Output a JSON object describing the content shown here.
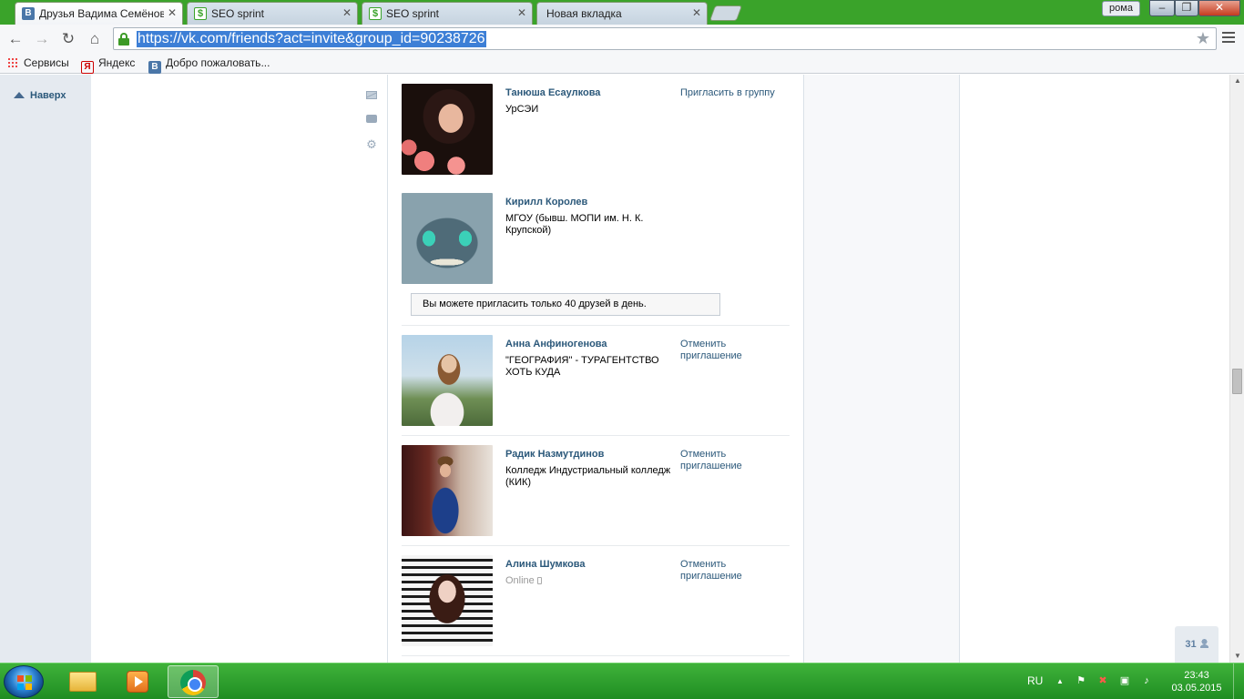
{
  "browser": {
    "tabs": [
      {
        "title": "Друзья Вадима Семёнова",
        "favicon": "vk-icon",
        "active": true
      },
      {
        "title": "SEO sprint",
        "favicon": "seo-sprint-icon",
        "active": false
      },
      {
        "title": "SEO sprint",
        "favicon": "seo-sprint-icon",
        "active": false
      },
      {
        "title": "Новая вкладка",
        "favicon": "none",
        "active": false
      }
    ],
    "profile_name": "рома",
    "url": "https://vk.com/friends?act=invite&group_id=90238726",
    "bookmarks": [
      {
        "label": "Сервисы",
        "icon": "apps-icon"
      },
      {
        "label": "Яндекс",
        "icon": "yandex-icon"
      },
      {
        "label": "Добро пожаловать...",
        "icon": "vk-icon"
      }
    ]
  },
  "page": {
    "scroll_up_label": "Наверх",
    "notice": "Вы можете пригласить только 40 друзей в день.",
    "online_count": "31",
    "friends": [
      {
        "name": "Танюша Есаулкова",
        "info": "УрСЭИ",
        "action": "Пригласить в группу",
        "online": false
      },
      {
        "name": "Кирилл Королев",
        "info": "МГОУ (бывш. МОПИ им. Н. К. Крупской)",
        "action": "",
        "online": false
      },
      {
        "name": "Анна Анфиногенова",
        "info": "\"ГЕОГРАФИЯ\" - ТУРАГЕНТСТВО ХОТЬ КУДА",
        "action": "Отменить приглашение",
        "online": false
      },
      {
        "name": "Радик Назмутдинов",
        "info": "Колледж Индустриальный колледж (КИК)",
        "action": "Отменить приглашение",
        "online": false
      },
      {
        "name": "Алина Шумкова",
        "info": "Online",
        "action": "Отменить приглашение",
        "online": true
      }
    ]
  },
  "taskbar": {
    "language": "RU",
    "time": "23:43",
    "date": "03.05.2015"
  },
  "colors": {
    "vk_link": "#2b587a",
    "taskbar_green": "#2a9e2c",
    "url_highlight": "#3d7fd6"
  }
}
